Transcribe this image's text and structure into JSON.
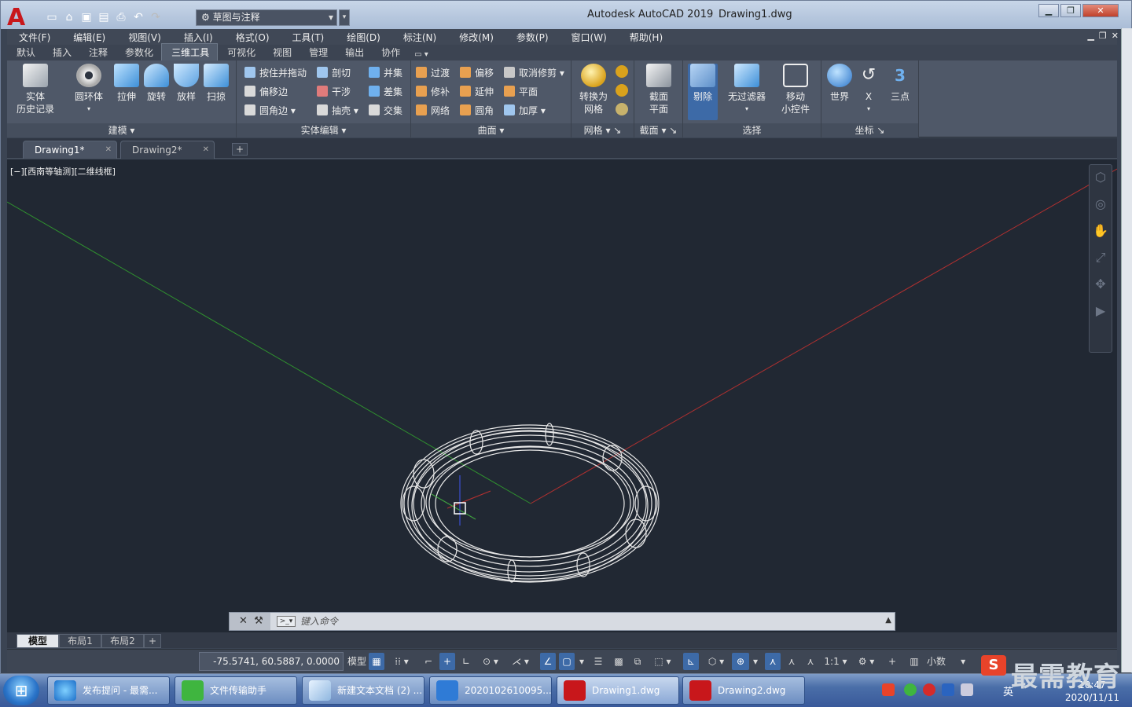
{
  "titlebar": {
    "app_name": "Autodesk AutoCAD 2019",
    "file_name": "Drawing1.dwg",
    "workspace": "草图与注释"
  },
  "menu": [
    "文件(F)",
    "编辑(E)",
    "视图(V)",
    "插入(I)",
    "格式(O)",
    "工具(T)",
    "绘图(D)",
    "标注(N)",
    "修改(M)",
    "参数(P)",
    "窗口(W)",
    "帮助(H)"
  ],
  "ribbon_tabs": [
    "默认",
    "插入",
    "注释",
    "参数化",
    "三维工具",
    "可视化",
    "视图",
    "管理",
    "输出",
    "协作"
  ],
  "active_ribbon_tab": "三维工具",
  "ribbon": {
    "modeling": {
      "title": "建模",
      "solid_history": [
        "实体",
        "历史记录"
      ],
      "torus": "圆环体",
      "extrude": "拉伸",
      "revolve": "旋转",
      "loft": "放样",
      "sweep": "扫掠"
    },
    "solid_edit": {
      "title": "实体编辑",
      "presspull": "按住并拖动",
      "offset_edge": "偏移边",
      "fillet_edge": "圆角边",
      "slice": "剖切",
      "interfere": "干涉",
      "shell": "抽壳",
      "union": "并集",
      "subtract": "差集",
      "intersect": "交集"
    },
    "surface": {
      "title": "曲面",
      "blend": "过渡",
      "patch": "修补",
      "network": "网络",
      "offset": "偏移",
      "extend": "延伸",
      "fillet": "圆角",
      "untrim": "取消修剪",
      "planar": "平面",
      "thicken": "加厚"
    },
    "mesh": {
      "title": "网格",
      "convert": [
        "转换为",
        "网格"
      ]
    },
    "section": {
      "title": "截面",
      "plane": [
        "截面",
        "平面"
      ]
    },
    "selection": {
      "title": "选择",
      "culling": "剔除",
      "no_filter": "无过滤器",
      "gizmo": [
        "移动",
        "小控件"
      ]
    },
    "coordinates": {
      "title": "坐标",
      "world": "世界",
      "x": "X",
      "three_point": "三点"
    }
  },
  "doc_tabs": [
    "Drawing1*",
    "Drawing2*"
  ],
  "viewport": {
    "label": "[−][西南等轴测][二维线框]",
    "axis_colors": {
      "x": "#b03030",
      "y": "#2f8f2f",
      "z": "#3a4fd0"
    }
  },
  "command": {
    "placeholder": "键入命令"
  },
  "layout_tabs": [
    "模型",
    "布局1",
    "布局2"
  ],
  "status": {
    "coords": "-75.5741, 60.5887, 0.0000",
    "model": "模型",
    "scale": "1:1",
    "units": "小数"
  },
  "taskbar": {
    "items": [
      "发布提问 - 最需...",
      "文件传输助手",
      "新建文本文档 (2) ...",
      "2020102610095...",
      "Drawing1.dwg",
      "Drawing2.dwg"
    ],
    "ime": "英",
    "time": "10:47",
    "date": "2020/11/11"
  },
  "watermark": "最需教育"
}
